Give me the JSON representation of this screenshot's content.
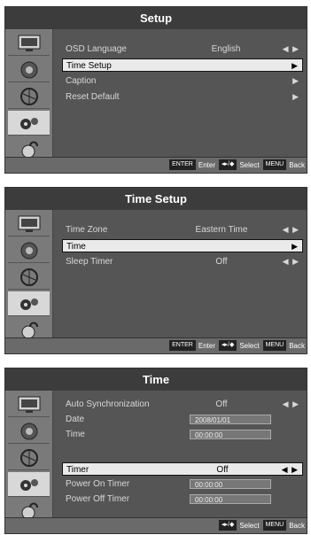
{
  "setup": {
    "title": "Setup",
    "rows": [
      {
        "label": "OSD Language",
        "value": "English",
        "arrows": "◀ ▶"
      },
      {
        "label": "Time Setup",
        "value": "",
        "arrows": "▶"
      },
      {
        "label": "Caption",
        "value": "",
        "arrows": "▶"
      },
      {
        "label": "Reset Default",
        "value": "",
        "arrows": "▶"
      }
    ]
  },
  "time_setup": {
    "title": "Time Setup",
    "rows": [
      {
        "label": "Time Zone",
        "value": "Eastern Time",
        "arrows": "◀ ▶"
      },
      {
        "label": "Time",
        "value": "",
        "arrows": "▶"
      },
      {
        "label": "Sleep Timer",
        "value": "Off",
        "arrows": "◀ ▶"
      }
    ]
  },
  "time": {
    "title": "Time",
    "rows": [
      {
        "label": "Auto Synchronization",
        "value": "Off",
        "arrows": "◀ ▶"
      },
      {
        "label": "Date",
        "value": "2008/01/01"
      },
      {
        "label": "Time",
        "value": "00:00:00"
      },
      {
        "label": "Timer",
        "value": "Off",
        "arrows": "◀ ▶"
      },
      {
        "label": "Power On Timer",
        "value": "00:00:00"
      },
      {
        "label": "Power Off Timer",
        "value": "00:00:00"
      }
    ]
  },
  "footer": {
    "enter_key": "ENTER",
    "enter_label": "Enter",
    "select_key": "◂▸/◆",
    "select_label": "Select",
    "menu_key": "MENU",
    "menu_label": "Back"
  },
  "icons": [
    "picture-icon",
    "sound-icon",
    "channel-icon",
    "setup-icon",
    "lock-icon"
  ]
}
